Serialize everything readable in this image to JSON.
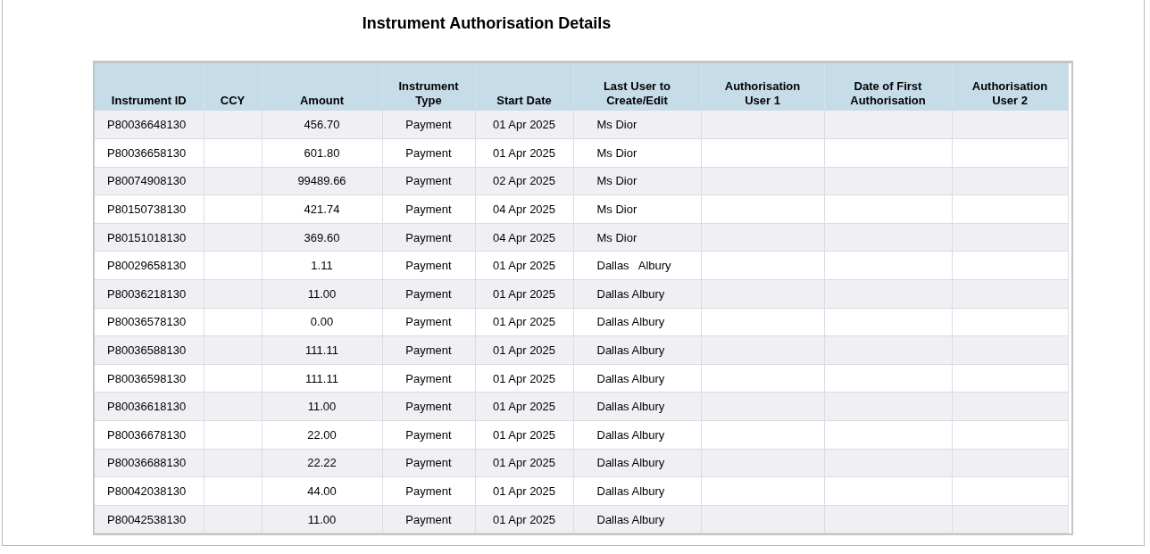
{
  "title": "Instrument Authorisation Details",
  "table": {
    "columns": [
      "Instrument ID",
      "CCY",
      "Amount",
      "Instrument\nType",
      "Start Date",
      "Last User to\nCreate/Edit",
      "Authorisation\nUser 1",
      "Date of First\nAuthorisation",
      "Authorisation\nUser 2"
    ],
    "rows": [
      [
        "P80036648130",
        "",
        "456.70",
        "Payment",
        "01 Apr 2025",
        "Ms Dior",
        "",
        "",
        ""
      ],
      [
        "P80036658130",
        "",
        "601.80",
        "Payment",
        "01 Apr 2025",
        "Ms Dior",
        "",
        "",
        ""
      ],
      [
        "P80074908130",
        "",
        "99489.66",
        "Payment",
        "02 Apr 2025",
        "Ms Dior",
        "",
        "",
        ""
      ],
      [
        "P80150738130",
        "",
        "421.74",
        "Payment",
        "04 Apr 2025",
        "Ms Dior",
        "",
        "",
        ""
      ],
      [
        "P80151018130",
        "",
        "369.60",
        "Payment",
        "04 Apr 2025",
        "Ms Dior",
        "",
        "",
        ""
      ],
      [
        "P80029658130",
        "",
        "1.11",
        "Payment",
        "01 Apr 2025",
        "Dallas   Albury",
        "",
        "",
        ""
      ],
      [
        "P80036218130",
        "",
        "11.00",
        "Payment",
        "01 Apr 2025",
        "Dallas Albury",
        "",
        "",
        ""
      ],
      [
        "P80036578130",
        "",
        "0.00",
        "Payment",
        "01 Apr 2025",
        "Dallas Albury",
        "",
        "",
        ""
      ],
      [
        "P80036588130",
        "",
        "111.11",
        "Payment",
        "01 Apr 2025",
        "Dallas Albury",
        "",
        "",
        ""
      ],
      [
        "P80036598130",
        "",
        "111.11",
        "Payment",
        "01 Apr 2025",
        "Dallas Albury",
        "",
        "",
        ""
      ],
      [
        "P80036618130",
        "",
        "11.00",
        "Payment",
        "01 Apr 2025",
        "Dallas Albury",
        "",
        "",
        ""
      ],
      [
        "P80036678130",
        "",
        "22.00",
        "Payment",
        "01 Apr 2025",
        "Dallas Albury",
        "",
        "",
        ""
      ],
      [
        "P80036688130",
        "",
        "22.22",
        "Payment",
        "01 Apr 2025",
        "Dallas Albury",
        "",
        "",
        ""
      ],
      [
        "P80042038130",
        "",
        "44.00",
        "Payment",
        "01 Apr 2025",
        "Dallas Albury",
        "",
        "",
        ""
      ],
      [
        "P80042538130",
        "",
        "11.00",
        "Payment",
        "01 Apr 2025",
        "Dallas Albury",
        "",
        "",
        ""
      ]
    ]
  }
}
